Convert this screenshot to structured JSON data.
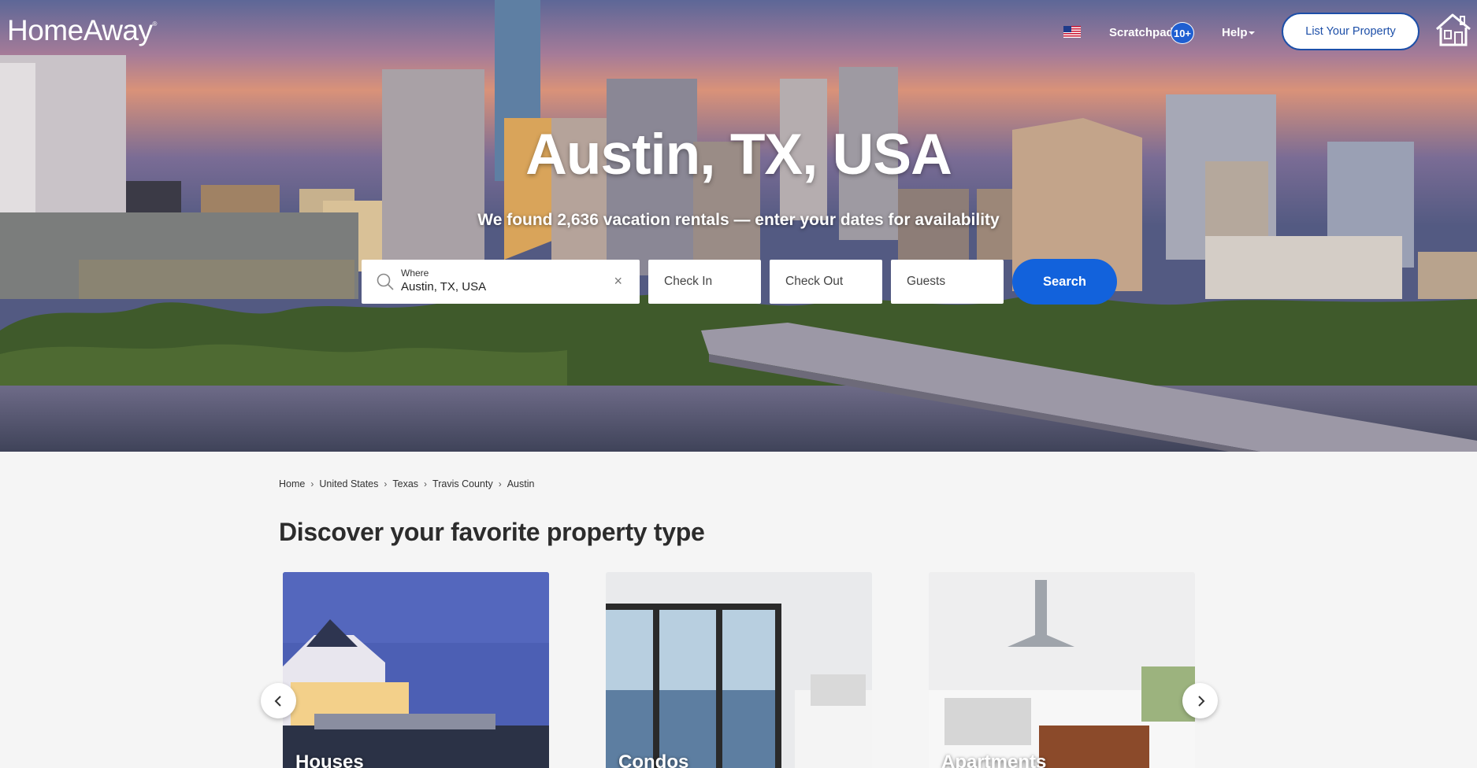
{
  "header": {
    "logo": "HomeAway",
    "logo_mark": "®",
    "flag_icon": "us-flag-icon",
    "scratchpad_label": "Scratchpad",
    "scratchpad_count": "10+",
    "help_label": "Help",
    "list_property_label": "List Your Property",
    "account_icon": "house-icon"
  },
  "hero": {
    "title": "Austin, TX, USA",
    "subtitle": "We found 2,636 vacation rentals — enter your dates for availability"
  },
  "search": {
    "where_label": "Where",
    "where_value": "Austin, TX, USA",
    "clear_icon": "×",
    "check_in": "Check In",
    "check_out": "Check Out",
    "guests": "Guests",
    "search_button": "Search"
  },
  "breadcrumb": [
    "Home",
    "United States",
    "Texas",
    "Travis County",
    "Austin"
  ],
  "property_section": {
    "title": "Discover your favorite property type",
    "cards": [
      "Houses",
      "Condos",
      "Apartments"
    ]
  },
  "colors": {
    "accent": "#1262dc",
    "brand_blue": "#1d4fa8",
    "page_bg": "#f5f5f5"
  }
}
